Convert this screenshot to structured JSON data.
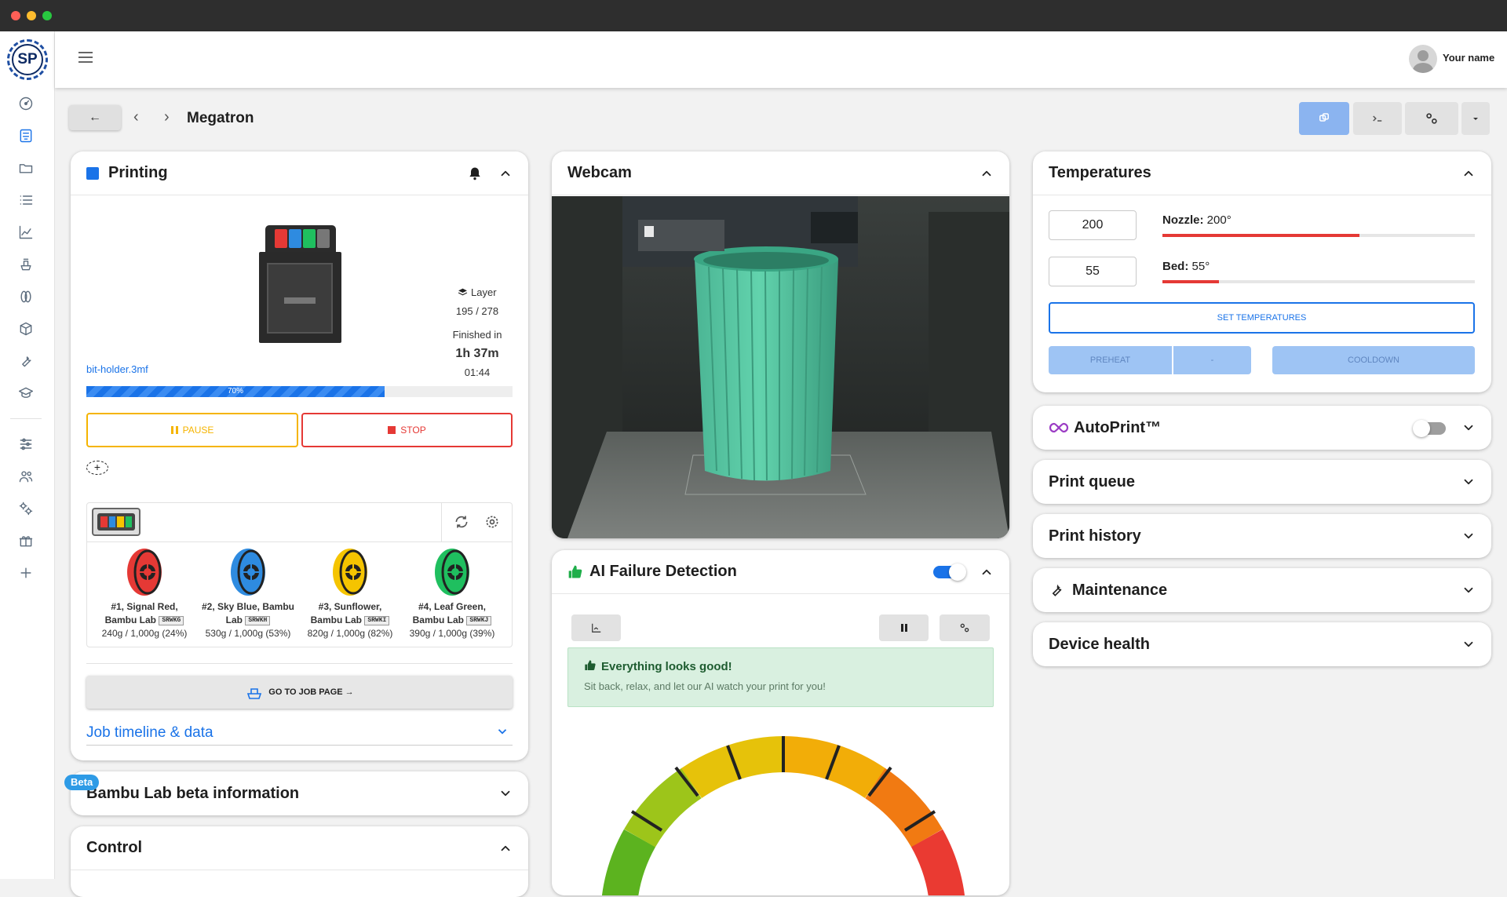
{
  "window": {
    "dot_colors": [
      "#ff5f57",
      "#febc2e",
      "#28c840"
    ]
  },
  "app": {
    "logo_text": "SP"
  },
  "nav": {
    "items": [
      "dashboard-icon",
      "printers-icon",
      "files-icon",
      "queue-icon",
      "stats-icon",
      "jobs-icon",
      "filament-icon",
      "models-icon",
      "maintenance-icon",
      "learn-icon",
      "settings-icon",
      "users-icon",
      "integrations-icon",
      "gift-icon",
      "add-icon"
    ]
  },
  "user": {
    "name": "Your name"
  },
  "breadcrumb": {
    "title": "Megatron"
  },
  "printing": {
    "title": "Printing",
    "status_color": "#1a73e8",
    "file_name": "bit-holder.3mf",
    "layer_label": "Layer",
    "layer_value": "195 / 278",
    "finished_label": "Finished in",
    "finished_value": "1h 37m",
    "finished_time": "01:44",
    "progress": 0.7,
    "progress_label": "70%",
    "pause_label": "PAUSE",
    "stop_label": "STOP",
    "spools": [
      {
        "line1": "#1, Signal Red,",
        "line2": "Bambu Lab",
        "tag": "SRWKG",
        "line3": "240g / 1,000g (24%)",
        "color": "#e53935"
      },
      {
        "line1": "#2, Sky Blue, Bambu",
        "line2": "Lab",
        "tag": "SRWKH",
        "line3": "530g / 1,000g (53%)",
        "color": "#2e8be0"
      },
      {
        "line1": "#3, Sunflower,",
        "line2": "Bambu Lab",
        "tag": "SRWKI",
        "line3": "820g / 1,000g (82%)",
        "color": "#f5c400"
      },
      {
        "line1": "#4, Leaf Green,",
        "line2": "Bambu Lab",
        "tag": "SRWKJ",
        "line3": "390g / 1,000g (39%)",
        "color": "#1fbf5f"
      }
    ],
    "job_page_label": "GO TO JOB PAGE →",
    "timeline_label": "Job timeline & data"
  },
  "beta": {
    "badge": "Beta",
    "title": "Bambu Lab beta information"
  },
  "control": {
    "title": "Control"
  },
  "webcam": {
    "title": "Webcam"
  },
  "ai": {
    "title": "AI Failure Detection",
    "toggle_on": true,
    "ok_title": "Everything looks good!",
    "ok_text": "Sit back, relax, and let our AI watch your print for you!"
  },
  "temperatures": {
    "title": "Temperatures",
    "nozzle_input": "200",
    "bed_input": "55",
    "nozzle_label": "Nozzle:",
    "nozzle_value": "200°",
    "nozzle_fill": 0.63,
    "bed_label": "Bed:",
    "bed_value": "55°",
    "bed_fill": 0.18,
    "set_label": "SET TEMPERATURES",
    "preheat_label": "PREHEAT",
    "preheat_dropdown": "-",
    "cooldown_label": "COOLDOWN"
  },
  "sections": {
    "autoprint": "AutoPrint™",
    "queue": "Print queue",
    "history": "Print history",
    "maintenance": "Maintenance",
    "health": "Device health"
  },
  "colors": {
    "accent": "#1a73e8",
    "pause": "#f5b400",
    "stop": "#e53935",
    "success_bg": "#d9f0e0",
    "success_text": "#1e7a3a"
  }
}
